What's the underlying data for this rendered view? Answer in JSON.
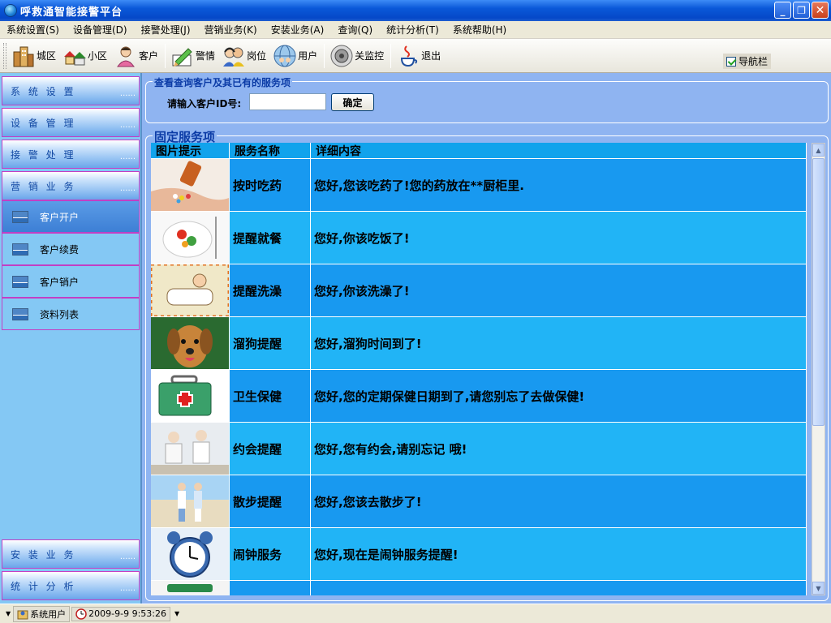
{
  "window": {
    "title": "呼救通智能接警平台",
    "controls": {
      "minimize": "_",
      "restore": "❐",
      "close": "✕"
    }
  },
  "menu": [
    "系统设置(S)",
    "设备管理(D)",
    "接警处理(J)",
    "营销业务(K)",
    "安装业务(A)",
    "查询(Q)",
    "统计分析(T)",
    "系统帮助(H)"
  ],
  "toolbar": {
    "buttons": [
      {
        "label": "城区",
        "icon": "city-buildings-icon"
      },
      {
        "label": "小区",
        "icon": "houses-icon"
      },
      {
        "label": "客户",
        "icon": "customer-icon"
      },
      {
        "label": "警情",
        "icon": "alert-pen-icon"
      },
      {
        "label": "岗位",
        "icon": "operators-icon"
      },
      {
        "label": "用户",
        "icon": "users-globe-icon"
      },
      {
        "label": "关监控",
        "icon": "speaker-icon"
      },
      {
        "label": "退出",
        "icon": "java-cup-icon"
      }
    ],
    "nav_checkbox_label": "导航栏",
    "nav_checked": true
  },
  "sidebar": {
    "groups_top": [
      "系 统 设 置",
      "设 备 管 理",
      "接 警 处 理",
      "营 销 业 务"
    ],
    "sub_items": [
      "客户开户",
      "客户续费",
      "客户销户",
      "资料列表"
    ],
    "active_sub": 0,
    "groups_bottom": [
      "安 装 业 务",
      "统 计 分 析"
    ],
    "dots": "......"
  },
  "query": {
    "legend": "查看查询客户及其已有的服务项",
    "label": "请输入客户ID号:",
    "input_value": "",
    "ok_label": "确定"
  },
  "services": {
    "legend": "固定服务项",
    "columns": [
      "图片提示",
      "服务名称",
      "详细内容"
    ],
    "rows": [
      {
        "image": "medicine-pills",
        "name": "按时吃药",
        "detail": "您好,您该吃药了!您的药放在**厨柜里."
      },
      {
        "image": "food-plate",
        "name": "提醒就餐",
        "detail": "您好,你该吃饭了!"
      },
      {
        "image": "bath-illustration",
        "name": "提醒洗澡",
        "detail": "您好,你该洗澡了!"
      },
      {
        "image": "puppy-dog",
        "name": "溜狗提醒",
        "detail": "您好,溜狗时间到了!"
      },
      {
        "image": "first-aid-kit",
        "name": "卫生保健",
        "detail": "您好,您的定期保健日期到了,请您别忘了去做保健!"
      },
      {
        "image": "elderly-couple-sitting",
        "name": "约会提醒",
        "detail": "您好,您有约会,请别忘记  哦!"
      },
      {
        "image": "couple-walking-beach",
        "name": "散步提醒",
        "detail": "您好,您该去散步了!"
      },
      {
        "image": "alarm-clock",
        "name": "闹钟服务",
        "detail": "您好,现在是闹钟服务提醒!"
      },
      {
        "image": "partial-row",
        "name": "",
        "detail": ""
      }
    ]
  },
  "statusbar": {
    "user": "系统用户",
    "datetime": "2009-9-9  9:53:26"
  },
  "colors": {
    "titlebar": "#0a58d8",
    "sidebar_bg": "#84c8f4",
    "main_bg": "#8fb4f1",
    "row_a": "#1899f0",
    "row_b": "#21b4f6",
    "legend_text": "#0b3ba6"
  }
}
